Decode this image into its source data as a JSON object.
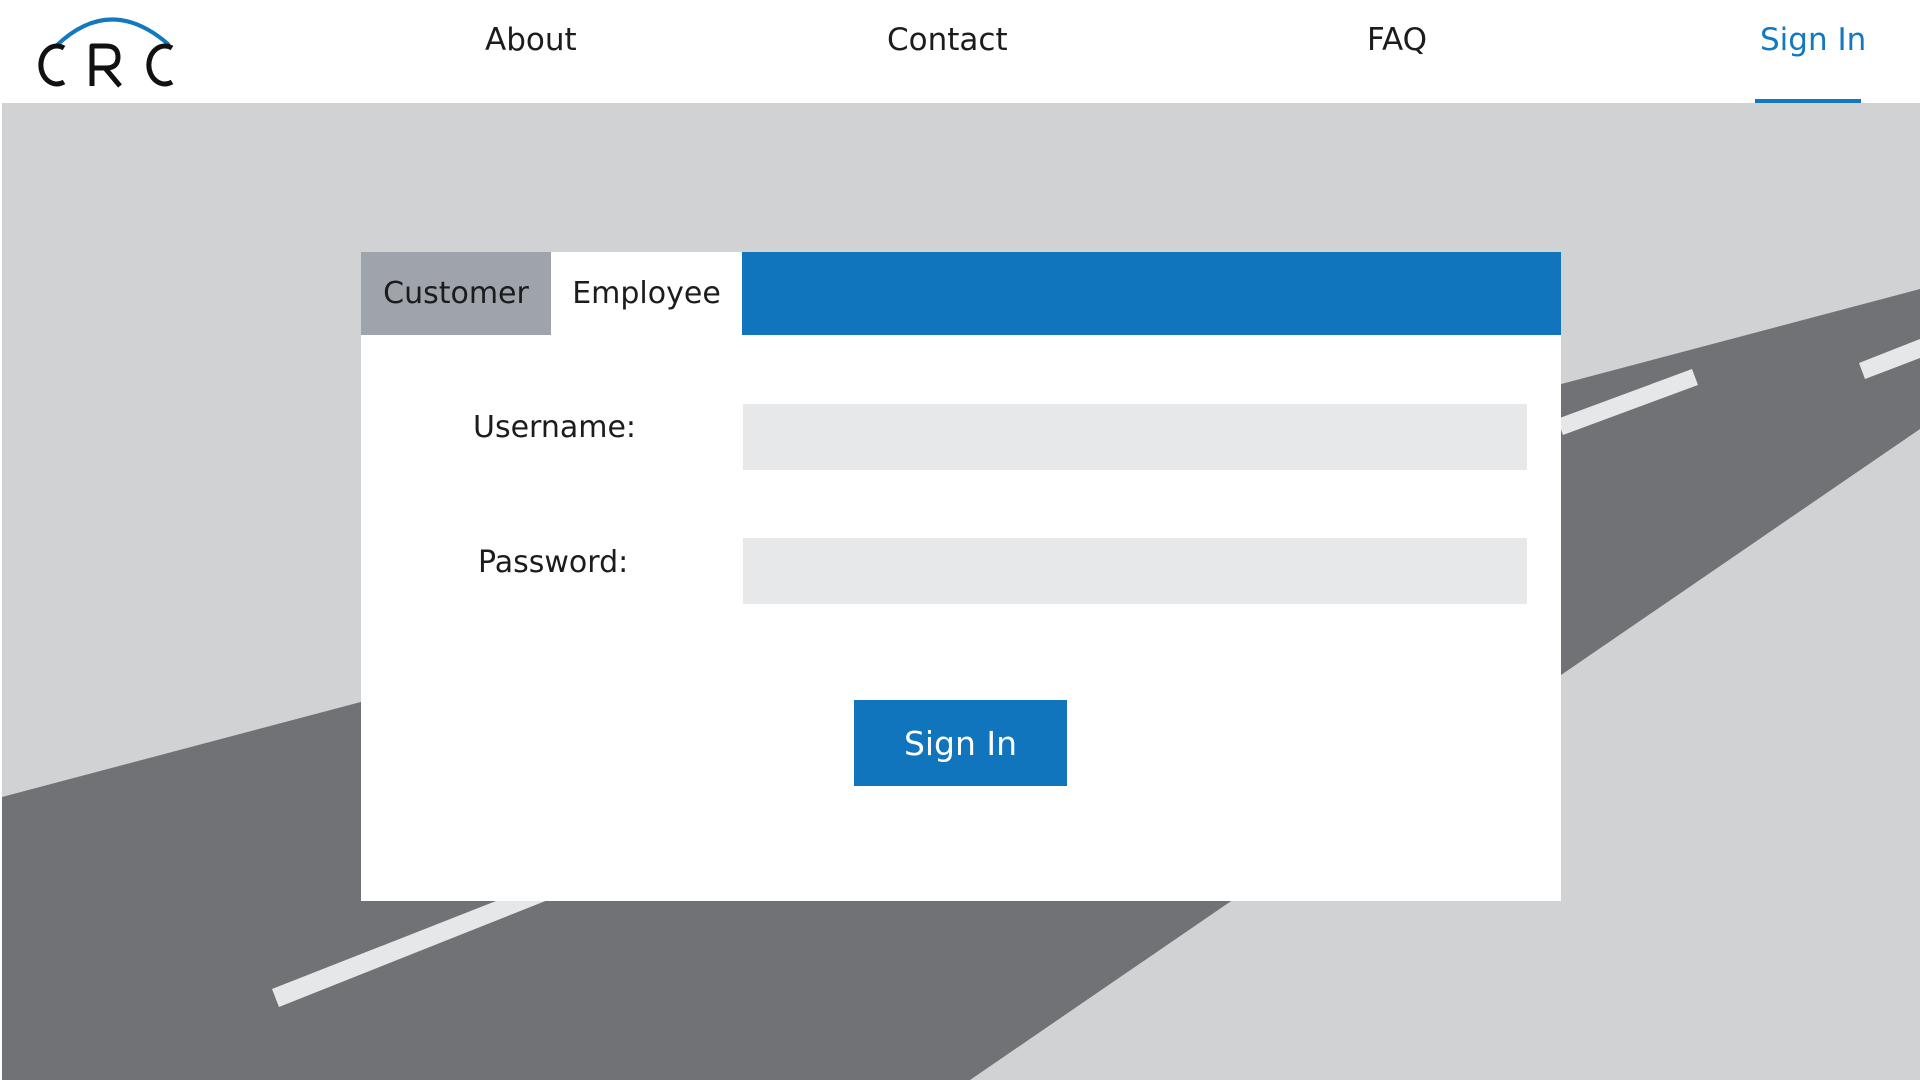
{
  "brand": {
    "logo_text": "CRC",
    "accent_color": "#1278bf"
  },
  "nav": {
    "items": [
      {
        "label": "About"
      },
      {
        "label": "Contact"
      },
      {
        "label": "FAQ"
      },
      {
        "label": "Sign In",
        "active": true
      }
    ]
  },
  "login": {
    "tabs": [
      {
        "label": "Customer",
        "selected": false
      },
      {
        "label": "Employee",
        "selected": true
      }
    ],
    "username_label": "Username:",
    "username_value": "",
    "password_label": "Password:",
    "password_value": "",
    "submit_label": "Sign In"
  },
  "colors": {
    "primary": "#1075bd",
    "background": "#d1d2d4",
    "road": "#717276",
    "input_fill": "#e7e8e9",
    "inactive_tab": "#9fa3ac"
  }
}
